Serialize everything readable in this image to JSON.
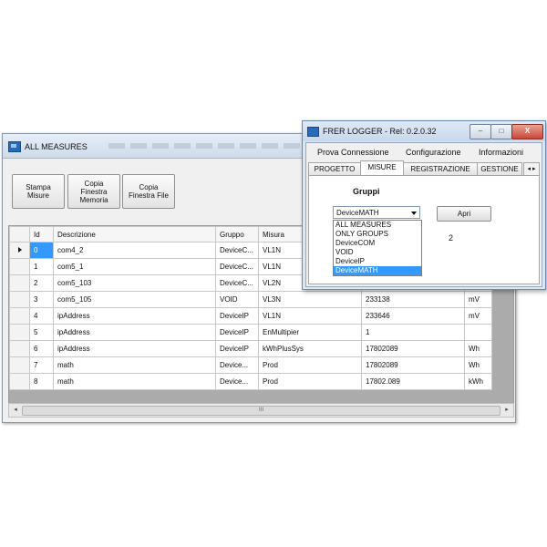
{
  "main_window": {
    "title": "ALL MEASURES",
    "toolbar": {
      "stampa_misure": "Stampa\nMisure",
      "copia_memoria": "Copia\nFinestra\nMemoria",
      "copia_file": "Copia\nFinestra File"
    },
    "grid": {
      "columns": [
        "Id",
        "Descrizione",
        "Gruppo",
        "Misura",
        "",
        ""
      ],
      "rows": [
        {
          "id": "0",
          "descrizione": "com4_2",
          "gruppo": "DeviceC...",
          "misura": "VL1N",
          "valore": "",
          "unita": ""
        },
        {
          "id": "1",
          "descrizione": "com5_1",
          "gruppo": "DeviceC...",
          "misura": "VL1N",
          "valore": "",
          "unita": ""
        },
        {
          "id": "2",
          "descrizione": "com5_103",
          "gruppo": "DeviceC...",
          "misura": "VL2N",
          "valore": "",
          "unita": ""
        },
        {
          "id": "3",
          "descrizione": "com5_105",
          "gruppo": "VOID",
          "misura": "VL3N",
          "valore": "233138",
          "unita": "mV"
        },
        {
          "id": "4",
          "descrizione": "ipAddress",
          "gruppo": "DeviceIP",
          "misura": "VL1N",
          "valore": "233646",
          "unita": "mV"
        },
        {
          "id": "5",
          "descrizione": "ipAddress",
          "gruppo": "DeviceIP",
          "misura": "EnMultipier",
          "valore": "1",
          "unita": ""
        },
        {
          "id": "6",
          "descrizione": "ipAddress",
          "gruppo": "DeviceIP",
          "misura": "kWhPlusSys",
          "valore": "17802089",
          "unita": "Wh"
        },
        {
          "id": "7",
          "descrizione": "math",
          "gruppo": "Device...",
          "misura": "Prod",
          "valore": "17802089",
          "unita": "Wh"
        },
        {
          "id": "8",
          "descrizione": "math",
          "gruppo": "Device...",
          "misura": "Prod",
          "valore": "17802.089",
          "unita": "kWh"
        }
      ]
    },
    "scrollbar": {
      "thumb_label": "III",
      "left_arrow": "◂",
      "right_arrow": "▸"
    }
  },
  "dialog": {
    "title": "FRER LOGGER -  Rel: 0.2.0.32",
    "window_buttons": {
      "minimize": "–",
      "maximize": "□",
      "close": "X"
    },
    "menu": [
      "Prova Connessione",
      "Configurazione",
      "Informazioni"
    ],
    "tabs": [
      "PROGETTO",
      "MISURE",
      "REGISTRAZIONE",
      "GESTIONE"
    ],
    "active_tab": "MISURE",
    "tab_arrows": "◂ ▸",
    "gruppi_label": "Gruppi",
    "combo_value": "DeviceMATH",
    "apri_label": "Apri",
    "count_value": "2",
    "dropdown_options": [
      "ALL MEASURES",
      "ONLY GROUPS",
      "DeviceCOM",
      "VOID",
      "DeviceIP",
      "DeviceMATH"
    ],
    "dropdown_selected": "DeviceMATH"
  }
}
